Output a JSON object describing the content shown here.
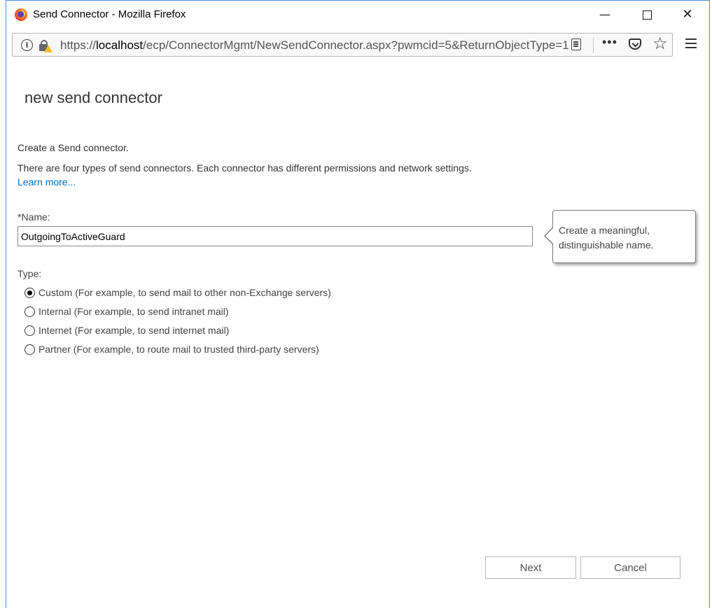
{
  "window": {
    "title": "Send Connector - Mozilla Firefox",
    "min_glyph": "—",
    "close_glyph": "✕"
  },
  "browser": {
    "url_prefix": "https://",
    "url_host": "localhost",
    "url_path": "/ecp/ConnectorMgmt/NewSendConnector.aspx?pwmcid=5&ReturnObjectType=1",
    "info_glyph": "i",
    "more_glyph": "•••",
    "star_glyph": "☆"
  },
  "page": {
    "title": "new send connector",
    "intro": "Create a Send connector.",
    "description": "There are four types of send connectors. Each connector has different permissions and network settings.",
    "learn_more": "Learn more..."
  },
  "name_field": {
    "label": "*Name:",
    "value": "OutgoingToActiveGuard"
  },
  "callout": {
    "text": "Create a meaningful, distinguishable name."
  },
  "type": {
    "label": "Type:",
    "options": [
      {
        "label": "Custom (For example, to send mail to other non-Exchange servers)",
        "checked": true
      },
      {
        "label": "Internal (For example, to send intranet mail)",
        "checked": false
      },
      {
        "label": "Internet (For example, to send internet mail)",
        "checked": false
      },
      {
        "label": "Partner (For example, to route mail to trusted third-party servers)",
        "checked": false
      }
    ]
  },
  "buttons": {
    "next": "Next",
    "cancel": "Cancel"
  }
}
